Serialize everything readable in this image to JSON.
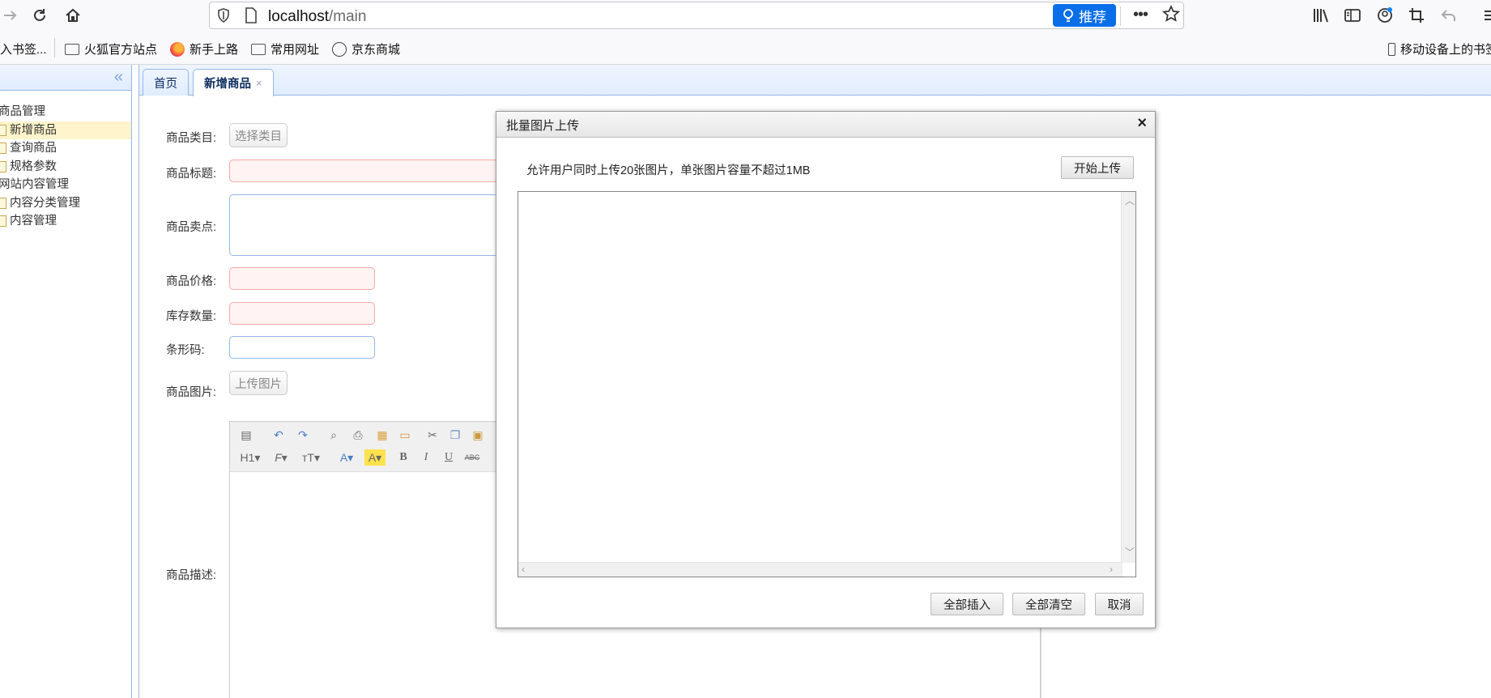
{
  "browser": {
    "url_host": "localhost",
    "url_path": "/main",
    "recommend_label": "推荐",
    "bookmarks": [
      "入书签...",
      "火狐官方站点",
      "新手上路",
      "常用网址",
      "京东商城"
    ],
    "mobile_bookmarks": "移动设备上的书签"
  },
  "sidebar": {
    "tree": [
      {
        "label": "商品管理",
        "level": 0
      },
      {
        "label": "新增商品",
        "level": 1,
        "selected": true
      },
      {
        "label": "查询商品",
        "level": 1
      },
      {
        "label": "规格参数",
        "level": 1
      },
      {
        "label": "网站内容管理",
        "level": 0
      },
      {
        "label": "内容分类管理",
        "level": 1
      },
      {
        "label": "内容管理",
        "level": 1
      }
    ]
  },
  "tabs": [
    {
      "label": "首页"
    },
    {
      "label": "新增商品",
      "active": true,
      "close": "×"
    }
  ],
  "form": {
    "category_label": "商品类目:",
    "category_button": "选择类目",
    "title_label": "商品标题:",
    "selling_point_label": "商品卖点:",
    "price_label": "商品价格:",
    "stock_label": "库存数量:",
    "barcode_label": "条形码:",
    "image_label": "商品图片:",
    "image_button": "上传图片",
    "desc_label": "商品描述:"
  },
  "dialog": {
    "title": "批量图片上传",
    "close": "×",
    "tip": "允许用户同时上传20张图片，单张图片容量不超过1MB",
    "start_upload": "开始上传",
    "insert_all": "全部插入",
    "clear_all": "全部清空",
    "cancel": "取消"
  }
}
